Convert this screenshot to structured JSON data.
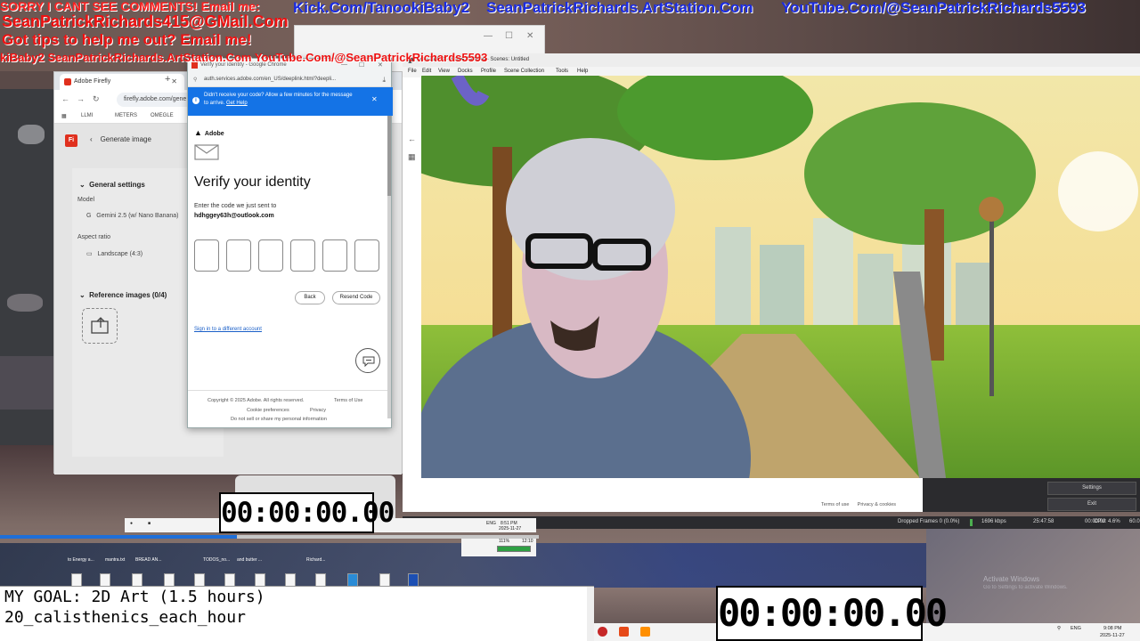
{
  "banner": {
    "line1_red": "SORRY I CANT SEE COMMENTS! Email me:",
    "line1_kick": "Kick.Com/TanookiBaby2",
    "line1_artstation": "SeanPatrickRichards.ArtStation.Com",
    "line1_youtube": "YouTube.Com/@SeanPatrickRichards5593",
    "line2": "SeanPatrickRichards415@GMail.Com",
    "line3": "Got tips to help me out? Email me!",
    "line4": "kiBaby2 SeanPatrickRichards.ArtStation.Com YouTube.Com/@SeanPatrickRichards5593"
  },
  "firefly": {
    "tab_title": "Adobe Firefly",
    "url": "firefly.adobe.com/gene",
    "bookmarks": [
      "LLMI",
      "METERS",
      "OMEGLE"
    ],
    "header": "Generate image",
    "logo": "Fi",
    "general_settings": "General settings",
    "model_label": "Model",
    "model_value": "Gemini 2.5 (w/ Nano Banana)",
    "aspect_label": "Aspect ratio",
    "aspect_value": "Landscape (4:3)",
    "reference_images": "Reference images (0/4)"
  },
  "verify": {
    "window_title": "Verify your identity - Google Chrome",
    "url": "auth.services.adobe.com/en_US/deeplink.html?deepli...",
    "alert_text": "Didn't receive your code? Allow a few minutes for the message to arrive.",
    "alert_link": "Get Help",
    "brand": "Adobe",
    "heading": "Verify your identity",
    "sent_label": "Enter the code we just sent to",
    "email": "hdhggey63h@outlook.com",
    "back_button": "Back",
    "resend_button": "Resend Code",
    "signin_link": "Sign in to a different account",
    "copyright": "Copyright © 2025 Adobe. All rights reserved.",
    "terms": "Terms of Use",
    "cookie": "Cookie preferences",
    "privacy": "Privacy",
    "do_not_sell": "Do not sell or share my personal information"
  },
  "obs": {
    "title": "OBS 31.0.3 - Profile: Untitled - Scenes: Untitled",
    "menu": [
      "File",
      "Edit",
      "View",
      "Docks",
      "Profile",
      "Scene Collection",
      "Tools",
      "Help"
    ],
    "settings_button": "Settings",
    "exit_button": "Exit",
    "terms_of_use": "Terms of use",
    "privacy_cookies": "Privacy & cookies",
    "dropped_frames": "Dropped Frames 0 (0.0%)",
    "bitrate": "1696 kbps",
    "live_time": "25:47:58",
    "rec_time": "00:00:00",
    "cpu": "CPU: 4.6%",
    "fps": "60.0"
  },
  "mini_taskbar": {
    "lang": "ENG",
    "time": "8:51 PM",
    "date": "2025-11-27",
    "clock2": "12:10",
    "battery": "111%",
    "progress": 0.44
  },
  "desktop_files": [
    "to Energy a...",
    "mantra.txt",
    "BREAD AN...",
    "TODOS_no...",
    "and butter ...",
    "Richard..."
  ],
  "timers": {
    "small": "00:00:00.00",
    "large": "00:00:00.00"
  },
  "goal": {
    "line1": "MY GOAL: 2D Art (1.5 hours)",
    "line2": "20_calisthenics_each_hour"
  },
  "activate": {
    "title": "Activate Windows",
    "sub": "Go to Settings to activate Windows."
  },
  "taskbar": {
    "lang": "ENG",
    "time": "9:08 PM",
    "date": "2025-11-27"
  },
  "colors": {
    "banner_red": "#ff2020",
    "banner_blue": "#1a2be0",
    "adobe_blue": "#1473e6",
    "adobe_red": "#e0301e"
  }
}
